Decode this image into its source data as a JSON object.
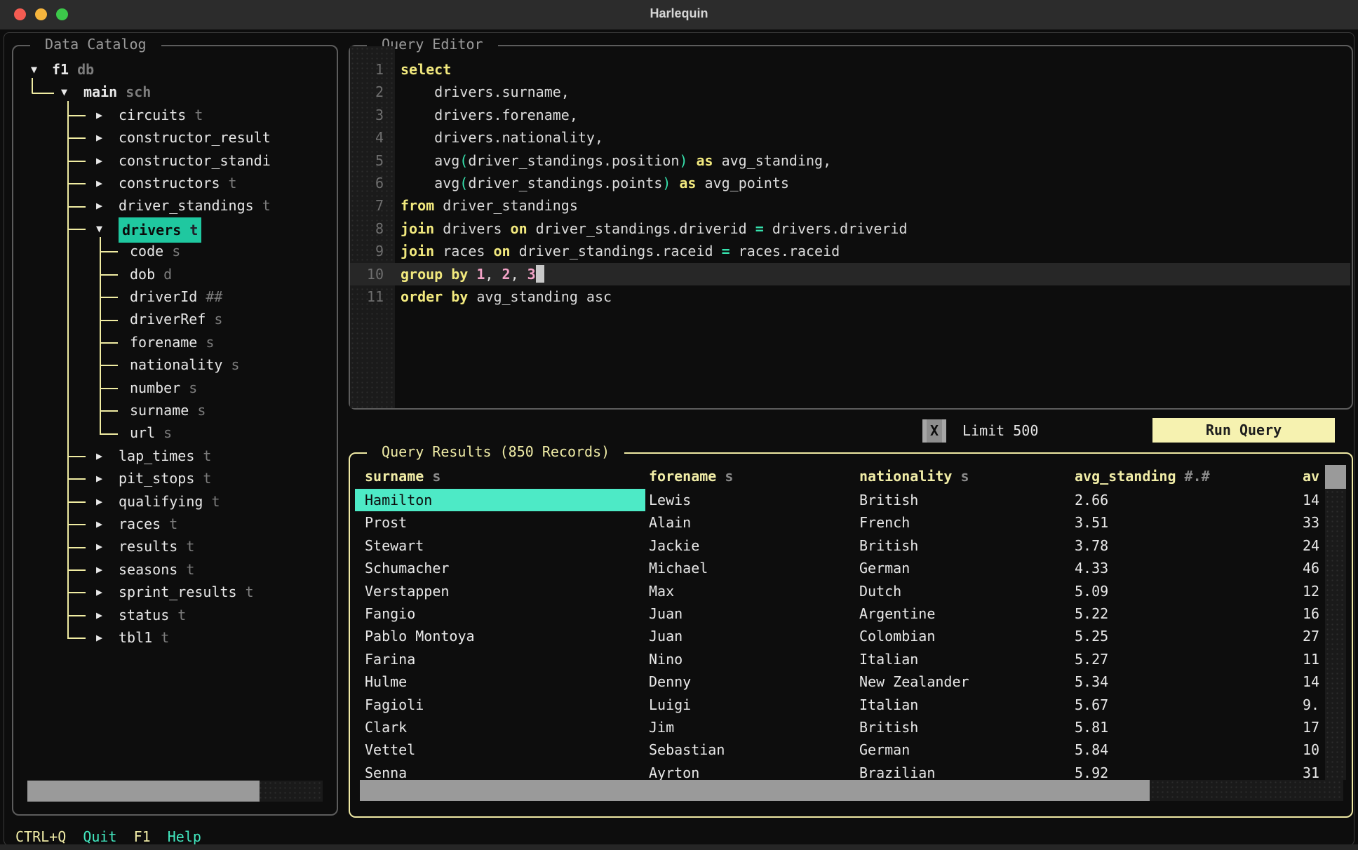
{
  "window": {
    "title": "Harlequin"
  },
  "catalog": {
    "title": " Data Catalog ",
    "tree": [
      {
        "label": "f1",
        "type": "db",
        "level": 0,
        "state": "expanded",
        "selected": false
      },
      {
        "label": "main",
        "type": "sch",
        "level": 1,
        "state": "expanded",
        "selected": false
      },
      {
        "label": "circuits",
        "type": "t",
        "level": 2,
        "state": "collapsed",
        "selected": false
      },
      {
        "label": "constructor_result",
        "type": "",
        "level": 2,
        "state": "collapsed",
        "selected": false
      },
      {
        "label": "constructor_standi",
        "type": "",
        "level": 2,
        "state": "collapsed",
        "selected": false
      },
      {
        "label": "constructors",
        "type": "t",
        "level": 2,
        "state": "collapsed",
        "selected": false
      },
      {
        "label": "driver_standings",
        "type": "t",
        "level": 2,
        "state": "collapsed",
        "selected": false
      },
      {
        "label": "drivers",
        "type": "t",
        "level": 2,
        "state": "expanded",
        "selected": true
      },
      {
        "label": "code",
        "type": "s",
        "level": 3,
        "state": "leaf",
        "selected": false
      },
      {
        "label": "dob",
        "type": "d",
        "level": 3,
        "state": "leaf",
        "selected": false
      },
      {
        "label": "driverId",
        "type": "##",
        "level": 3,
        "state": "leaf",
        "selected": false
      },
      {
        "label": "driverRef",
        "type": "s",
        "level": 3,
        "state": "leaf",
        "selected": false
      },
      {
        "label": "forename",
        "type": "s",
        "level": 3,
        "state": "leaf",
        "selected": false
      },
      {
        "label": "nationality",
        "type": "s",
        "level": 3,
        "state": "leaf",
        "selected": false
      },
      {
        "label": "number",
        "type": "s",
        "level": 3,
        "state": "leaf",
        "selected": false
      },
      {
        "label": "surname",
        "type": "s",
        "level": 3,
        "state": "leaf",
        "selected": false
      },
      {
        "label": "url",
        "type": "s",
        "level": 3,
        "state": "leaf",
        "selected": false
      },
      {
        "label": "lap_times",
        "type": "t",
        "level": 2,
        "state": "collapsed",
        "selected": false
      },
      {
        "label": "pit_stops",
        "type": "t",
        "level": 2,
        "state": "collapsed",
        "selected": false
      },
      {
        "label": "qualifying",
        "type": "t",
        "level": 2,
        "state": "collapsed",
        "selected": false
      },
      {
        "label": "races",
        "type": "t",
        "level": 2,
        "state": "collapsed",
        "selected": false
      },
      {
        "label": "results",
        "type": "t",
        "level": 2,
        "state": "collapsed",
        "selected": false
      },
      {
        "label": "seasons",
        "type": "t",
        "level": 2,
        "state": "collapsed",
        "selected": false
      },
      {
        "label": "sprint_results",
        "type": "t",
        "level": 2,
        "state": "collapsed",
        "selected": false
      },
      {
        "label": "status",
        "type": "t",
        "level": 2,
        "state": "collapsed",
        "selected": false
      },
      {
        "label": "tbl1",
        "type": "t",
        "level": 2,
        "state": "collapsed",
        "selected": false
      }
    ]
  },
  "editor": {
    "title": " Query Editor ",
    "lines": [
      {
        "num": "1",
        "current": false,
        "cursor": false,
        "segments": [
          [
            "keyword",
            "select"
          ]
        ]
      },
      {
        "num": "2",
        "current": false,
        "cursor": false,
        "segments": [
          [
            "identifier",
            "    drivers.surname,"
          ]
        ]
      },
      {
        "num": "3",
        "current": false,
        "cursor": false,
        "segments": [
          [
            "identifier",
            "    drivers.forename,"
          ]
        ]
      },
      {
        "num": "4",
        "current": false,
        "cursor": false,
        "segments": [
          [
            "identifier",
            "    drivers.nationality,"
          ]
        ]
      },
      {
        "num": "5",
        "current": false,
        "cursor": false,
        "segments": [
          [
            "identifier",
            "    avg"
          ],
          [
            "paren",
            "("
          ],
          [
            "identifier",
            "driver_standings.position"
          ],
          [
            "paren",
            ")"
          ],
          [
            "identifier",
            " "
          ],
          [
            "keyword",
            "as"
          ],
          [
            "identifier",
            " avg_standing,"
          ]
        ]
      },
      {
        "num": "6",
        "current": false,
        "cursor": false,
        "segments": [
          [
            "identifier",
            "    avg"
          ],
          [
            "paren",
            "("
          ],
          [
            "identifier",
            "driver_standings.points"
          ],
          [
            "paren",
            ")"
          ],
          [
            "identifier",
            " "
          ],
          [
            "keyword",
            "as"
          ],
          [
            "identifier",
            " avg_points"
          ]
        ]
      },
      {
        "num": "7",
        "current": false,
        "cursor": false,
        "segments": [
          [
            "keyword",
            "from"
          ],
          [
            "identifier",
            " driver_standings"
          ]
        ]
      },
      {
        "num": "8",
        "current": false,
        "cursor": false,
        "segments": [
          [
            "keyword",
            "join"
          ],
          [
            "identifier",
            " drivers "
          ],
          [
            "keyword",
            "on"
          ],
          [
            "identifier",
            " driver_standings.driverid "
          ],
          [
            "operator",
            "="
          ],
          [
            "identifier",
            " drivers.driverid"
          ]
        ]
      },
      {
        "num": "9",
        "current": false,
        "cursor": false,
        "segments": [
          [
            "keyword",
            "join"
          ],
          [
            "identifier",
            " races "
          ],
          [
            "keyword",
            "on"
          ],
          [
            "identifier",
            " driver_standings.raceid "
          ],
          [
            "operator",
            "="
          ],
          [
            "identifier",
            " races.raceid"
          ]
        ]
      },
      {
        "num": "10",
        "current": true,
        "cursor": true,
        "segments": [
          [
            "keyword",
            "group by"
          ],
          [
            "identifier",
            " "
          ],
          [
            "number",
            "1"
          ],
          [
            "identifier",
            ", "
          ],
          [
            "number",
            "2"
          ],
          [
            "identifier",
            ", "
          ],
          [
            "number",
            "3"
          ]
        ]
      },
      {
        "num": "11",
        "current": false,
        "cursor": false,
        "segments": [
          [
            "keyword",
            "order by"
          ],
          [
            "identifier",
            " avg_standing asc"
          ]
        ]
      }
    ]
  },
  "controls": {
    "limit_checkbox": "X",
    "limit_label": "Limit 500",
    "run_button": "Run Query"
  },
  "results": {
    "title": " Query Results (850 Records) ",
    "columns": [
      {
        "name": "surname",
        "type": "s"
      },
      {
        "name": "forename",
        "type": "s"
      },
      {
        "name": "nationality",
        "type": "s"
      },
      {
        "name": "avg_standing",
        "type": "#.#"
      },
      {
        "name": "av",
        "type": ""
      }
    ],
    "rows": [
      [
        "Hamilton",
        "Lewis",
        "British",
        "2.66",
        "14"
      ],
      [
        "Prost",
        "Alain",
        "French",
        "3.51",
        "33"
      ],
      [
        "Stewart",
        "Jackie",
        "British",
        "3.78",
        "24"
      ],
      [
        "Schumacher",
        "Michael",
        "German",
        "4.33",
        "46"
      ],
      [
        "Verstappen",
        "Max",
        "Dutch",
        "5.09",
        "12"
      ],
      [
        "Fangio",
        "Juan",
        "Argentine",
        "5.22",
        "16"
      ],
      [
        "Pablo Montoya",
        "Juan",
        "Colombian",
        "5.25",
        "27"
      ],
      [
        "Farina",
        "Nino",
        "Italian",
        "5.27",
        "11"
      ],
      [
        "Hulme",
        "Denny",
        "New Zealander",
        "5.34",
        "14"
      ],
      [
        "Fagioli",
        "Luigi",
        "Italian",
        "5.67",
        "9."
      ],
      [
        "Clark",
        "Jim",
        "British",
        "5.81",
        "17"
      ],
      [
        "Vettel",
        "Sebastian",
        "German",
        "5.84",
        "10"
      ],
      [
        "Senna",
        "Ayrton",
        "Brazilian",
        "5.92",
        "31"
      ]
    ],
    "selected_cell": {
      "row": 0,
      "col": 0
    }
  },
  "footer": {
    "items": [
      {
        "key": "CTRL+Q",
        "label": "Quit"
      },
      {
        "key": "F1",
        "label": "Help"
      }
    ]
  },
  "colors": {
    "tree_selection": "#1fc8a0",
    "cell_selection": "#4deac6",
    "keyword_yellow": "#f2e97e",
    "panel_yellow": "#efe9a4",
    "number_pink": "#f2a2c6",
    "teal_punctuation": "#36e2ad",
    "run_button_bg": "#f6f2b0"
  }
}
